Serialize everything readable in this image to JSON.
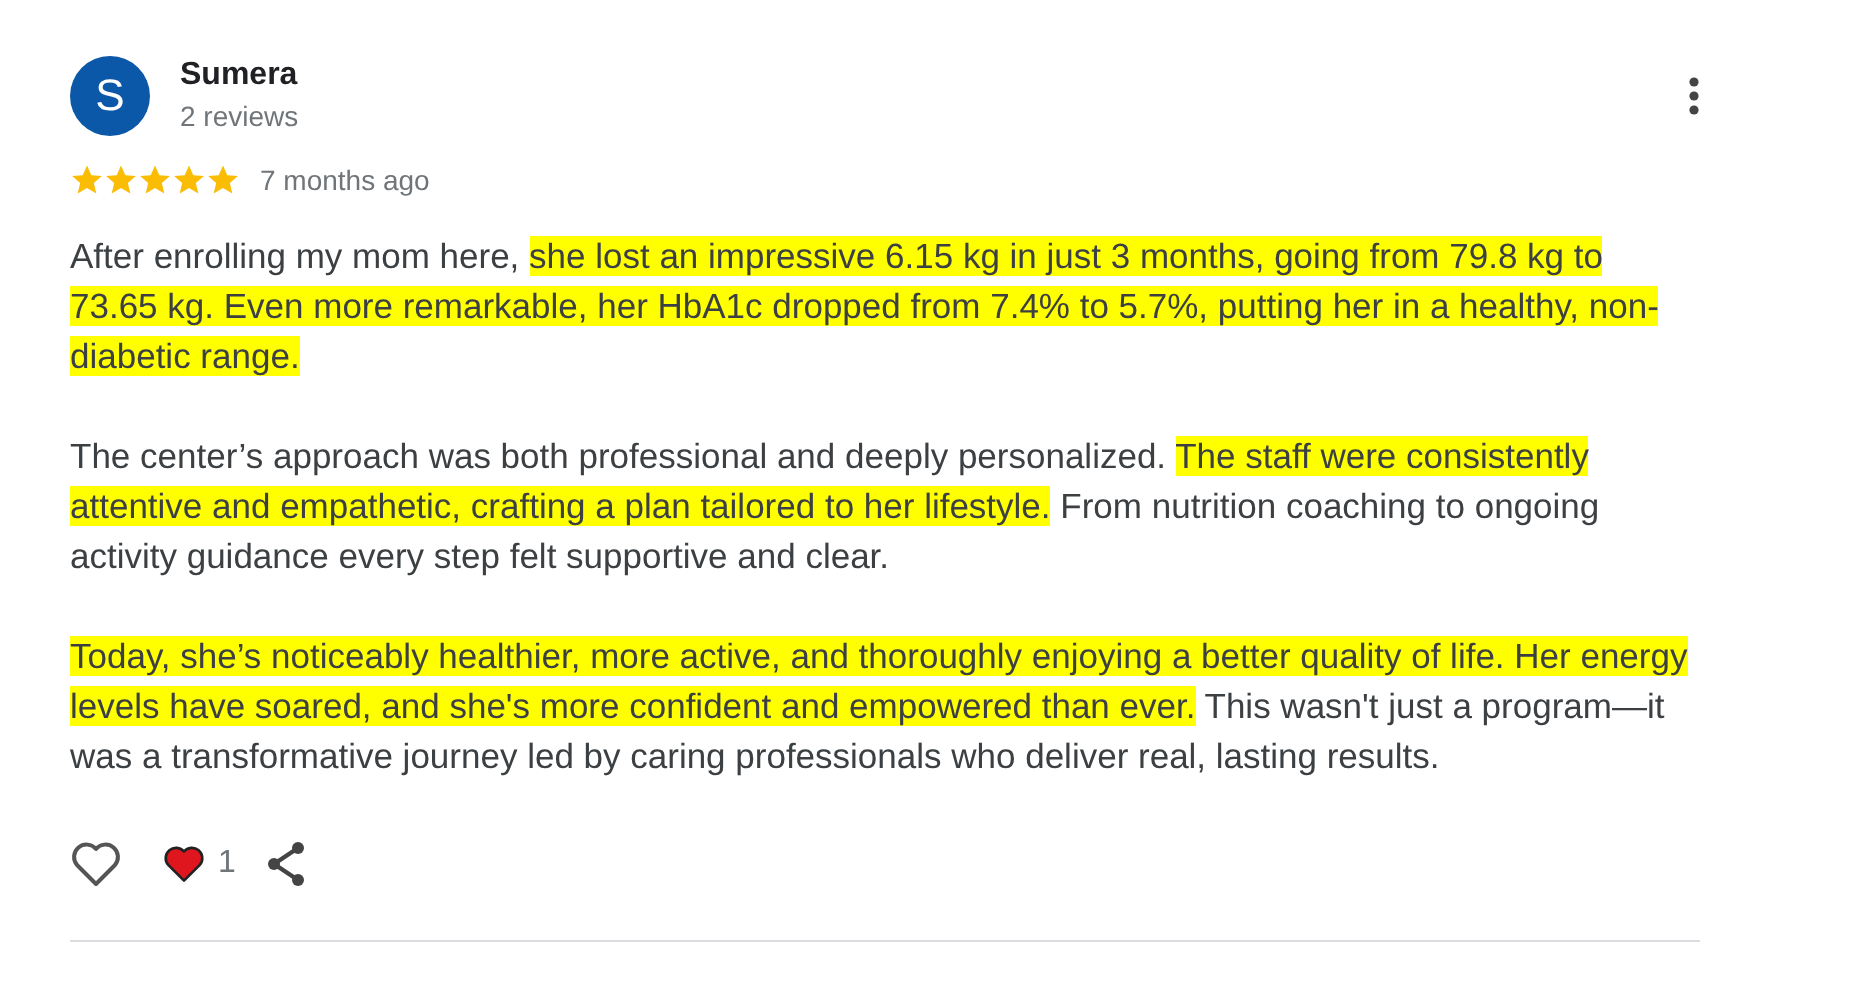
{
  "review": {
    "avatar_letter": "S",
    "author": "Sumera",
    "review_count": "2 reviews",
    "stars": 5,
    "time": "7 months ago",
    "paragraphs": [
      [
        {
          "text": "After enrolling my mom here, ",
          "highlighted": false
        },
        {
          "text": "she lost an impressive 6.15 kg in just 3 months, going from 79.8 kg to 73.65 kg. Even more remarkable, her HbA1c dropped from 7.4% to 5.7%, putting her in a healthy, non-diabetic range.",
          "highlighted": true
        }
      ],
      [
        {
          "text": "The center’s approach was both professional and deeply personalized. ",
          "highlighted": false
        },
        {
          "text": "The staff were consistently attentive and empathetic, crafting a plan tailored to her lifestyle.",
          "highlighted": true
        },
        {
          "text": " From nutrition coaching to ongoing activity guidance every step felt supportive and clear.",
          "highlighted": false
        }
      ],
      [
        {
          "text": "Today, she’s noticeably healthier, more active, and thoroughly enjoying a better quality of life. Her energy levels have soared, and she's more confident and empowered than ever.",
          "highlighted": true
        },
        {
          "text": " This wasn't just a program—it was a transformative journey led by caring professionals who deliver real, lasting results.",
          "highlighted": false
        }
      ]
    ],
    "reaction_count": "1"
  }
}
